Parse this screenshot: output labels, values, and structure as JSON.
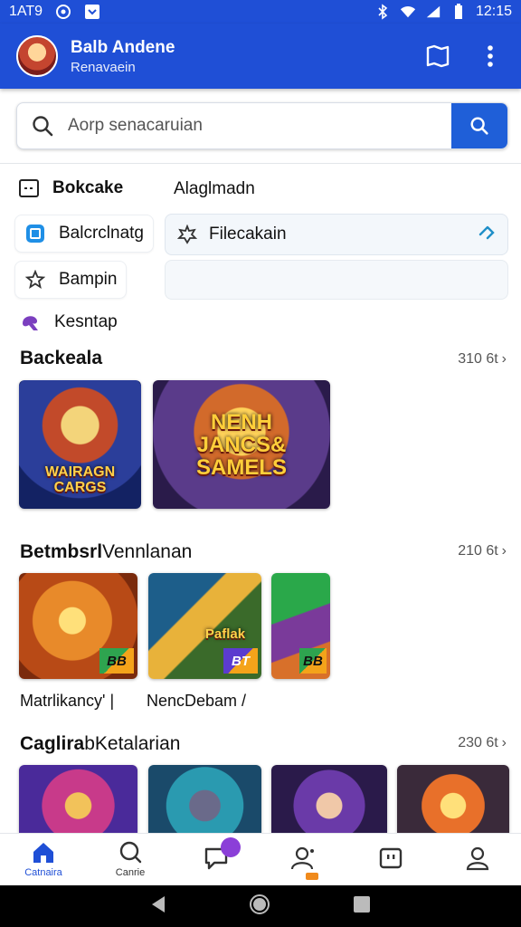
{
  "status_bar": {
    "time_left": "1AT9",
    "time_right": "12:15"
  },
  "app_bar": {
    "title": "Balb Andene",
    "subtitle": "Renavaein"
  },
  "search": {
    "placeholder": "Aorp senacaruian"
  },
  "quick_menu": {
    "items": [
      {
        "label": "Bokcake",
        "icon": "dashboard-icon"
      },
      {
        "label": "Balcrclnatg",
        "icon": "app-icon"
      },
      {
        "label": "Bampin",
        "icon": "badge-icon"
      },
      {
        "label": "Kesntap",
        "icon": "controller-icon"
      }
    ],
    "right_label": "Alaglmadn",
    "filter_label": "Filecakain"
  },
  "sections": [
    {
      "title": "Backeala",
      "count": "310 6t"
    },
    {
      "title": "BetmbsrlVennlanan",
      "count": "210 6t"
    },
    {
      "title": "CaglirabKetalarian",
      "count": "230 6t"
    }
  ],
  "tiles": {
    "featured": [
      {
        "text": "WAIRAGN\nCARGS"
      },
      {
        "text": "NENH\nJANCS&\nSAMELS"
      }
    ],
    "section2": [
      {
        "badge": "BB"
      },
      {
        "badge": "BT",
        "overlay": "Paflak"
      },
      {
        "badge": "BB"
      }
    ]
  },
  "captions": [
    "Matrlikancy' |",
    "NencDebam /"
  ],
  "bottom_nav": [
    {
      "label": "Catnaira",
      "icon": "home-icon",
      "active": true
    },
    {
      "label": "Canrie",
      "icon": "search-icon"
    },
    {
      "label": "",
      "icon": "chat-icon"
    },
    {
      "label": "",
      "icon": "friends-icon"
    },
    {
      "label": "",
      "icon": "inbox-icon"
    },
    {
      "label": "",
      "icon": "profile-icon"
    }
  ],
  "colors": {
    "primary": "#1f4fd6",
    "accent": "#1f5fd8",
    "badge_purple": "#8b3fd8"
  }
}
